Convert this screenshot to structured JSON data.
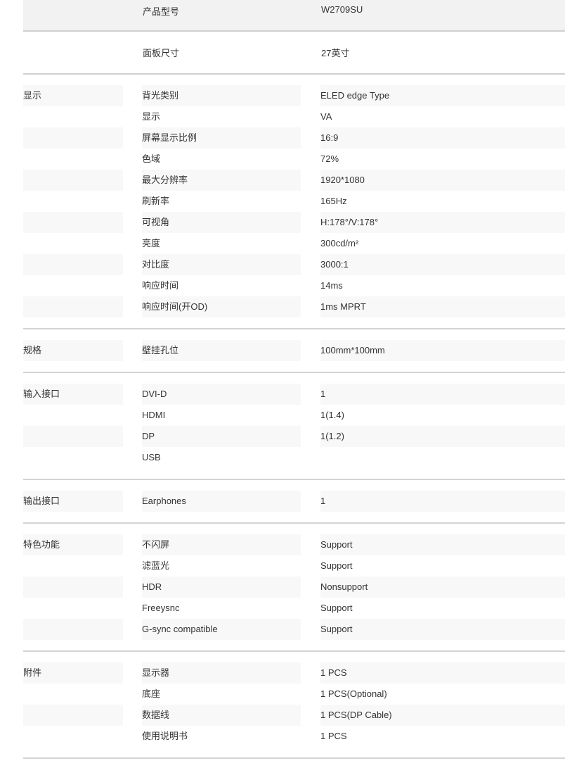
{
  "header_rows": [
    {
      "label": "产品型号",
      "value": "W2709SU"
    },
    {
      "label": "面板尺寸",
      "value": "27英寸"
    }
  ],
  "sections": [
    {
      "category": "显示",
      "rows": [
        {
          "label": "背光类别",
          "value": "ELED edge Type"
        },
        {
          "label": "显示",
          "value": "VA"
        },
        {
          "label": "屏幕显示比例",
          "value": "16:9"
        },
        {
          "label": "色域",
          "value": "72%"
        },
        {
          "label": "最大分辨率",
          "value": "1920*1080"
        },
        {
          "label": "刷新率",
          "value": "165Hz"
        },
        {
          "label": "可视角",
          "value": "H:178°/V:178°"
        },
        {
          "label": "亮度",
          "value": "300cd/m²"
        },
        {
          "label": "对比度",
          "value": "3000:1"
        },
        {
          "label": "响应时间",
          "value": "14ms"
        },
        {
          "label": "响应时间(开OD)",
          "value": "1ms MPRT"
        }
      ]
    },
    {
      "category": "规格",
      "rows": [
        {
          "label": "壁挂孔位",
          "value": "100mm*100mm"
        }
      ]
    },
    {
      "category": "输入接口",
      "rows": [
        {
          "label": "DVI-D",
          "value": "1"
        },
        {
          "label": "HDMI",
          "value": "1(1.4)"
        },
        {
          "label": "DP",
          "value": "1(1.2)"
        },
        {
          "label": "USB",
          "value": ""
        }
      ]
    },
    {
      "category": "输出接口",
      "rows": [
        {
          "label": "Earphones",
          "value": "1"
        }
      ]
    },
    {
      "category": "特色功能",
      "rows": [
        {
          "label": "不闪屏",
          "value": "Support"
        },
        {
          "label": "滤蓝光",
          "value": "Support"
        },
        {
          "label": "HDR",
          "value": "Nonsupport"
        },
        {
          "label": "Freeysnc",
          "value": "Support"
        },
        {
          "label": "G-sync compatible",
          "value": "Support"
        }
      ]
    },
    {
      "category": "附件",
      "rows": [
        {
          "label": "显示器",
          "value": "1 PCS"
        },
        {
          "label": "底座",
          "value": "1 PCS(Optional)"
        },
        {
          "label": "数据线",
          "value": "1 PCS(DP Cable)"
        },
        {
          "label": "使用说明书",
          "value": "1 PCS"
        }
      ]
    }
  ]
}
